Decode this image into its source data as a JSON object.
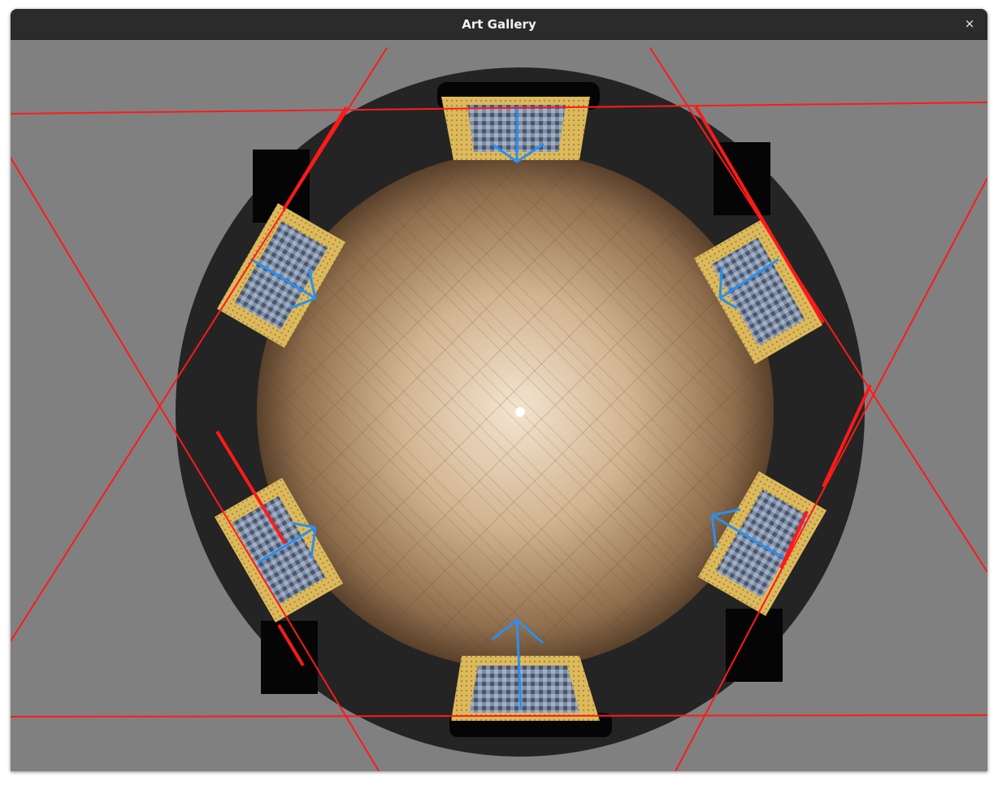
{
  "window": {
    "title": "Art Gallery",
    "close_icon": "close-icon",
    "close_glyph": "×"
  },
  "scene": {
    "floor_texture": "herringbone-wood",
    "paintings_count": 6,
    "overlay_colors": {
      "frustum_lines": "#ff1a1a",
      "direction_arrows": "#2b8ff0",
      "frame": "#d9b551",
      "wall": "#232323",
      "background": "#808080"
    }
  }
}
